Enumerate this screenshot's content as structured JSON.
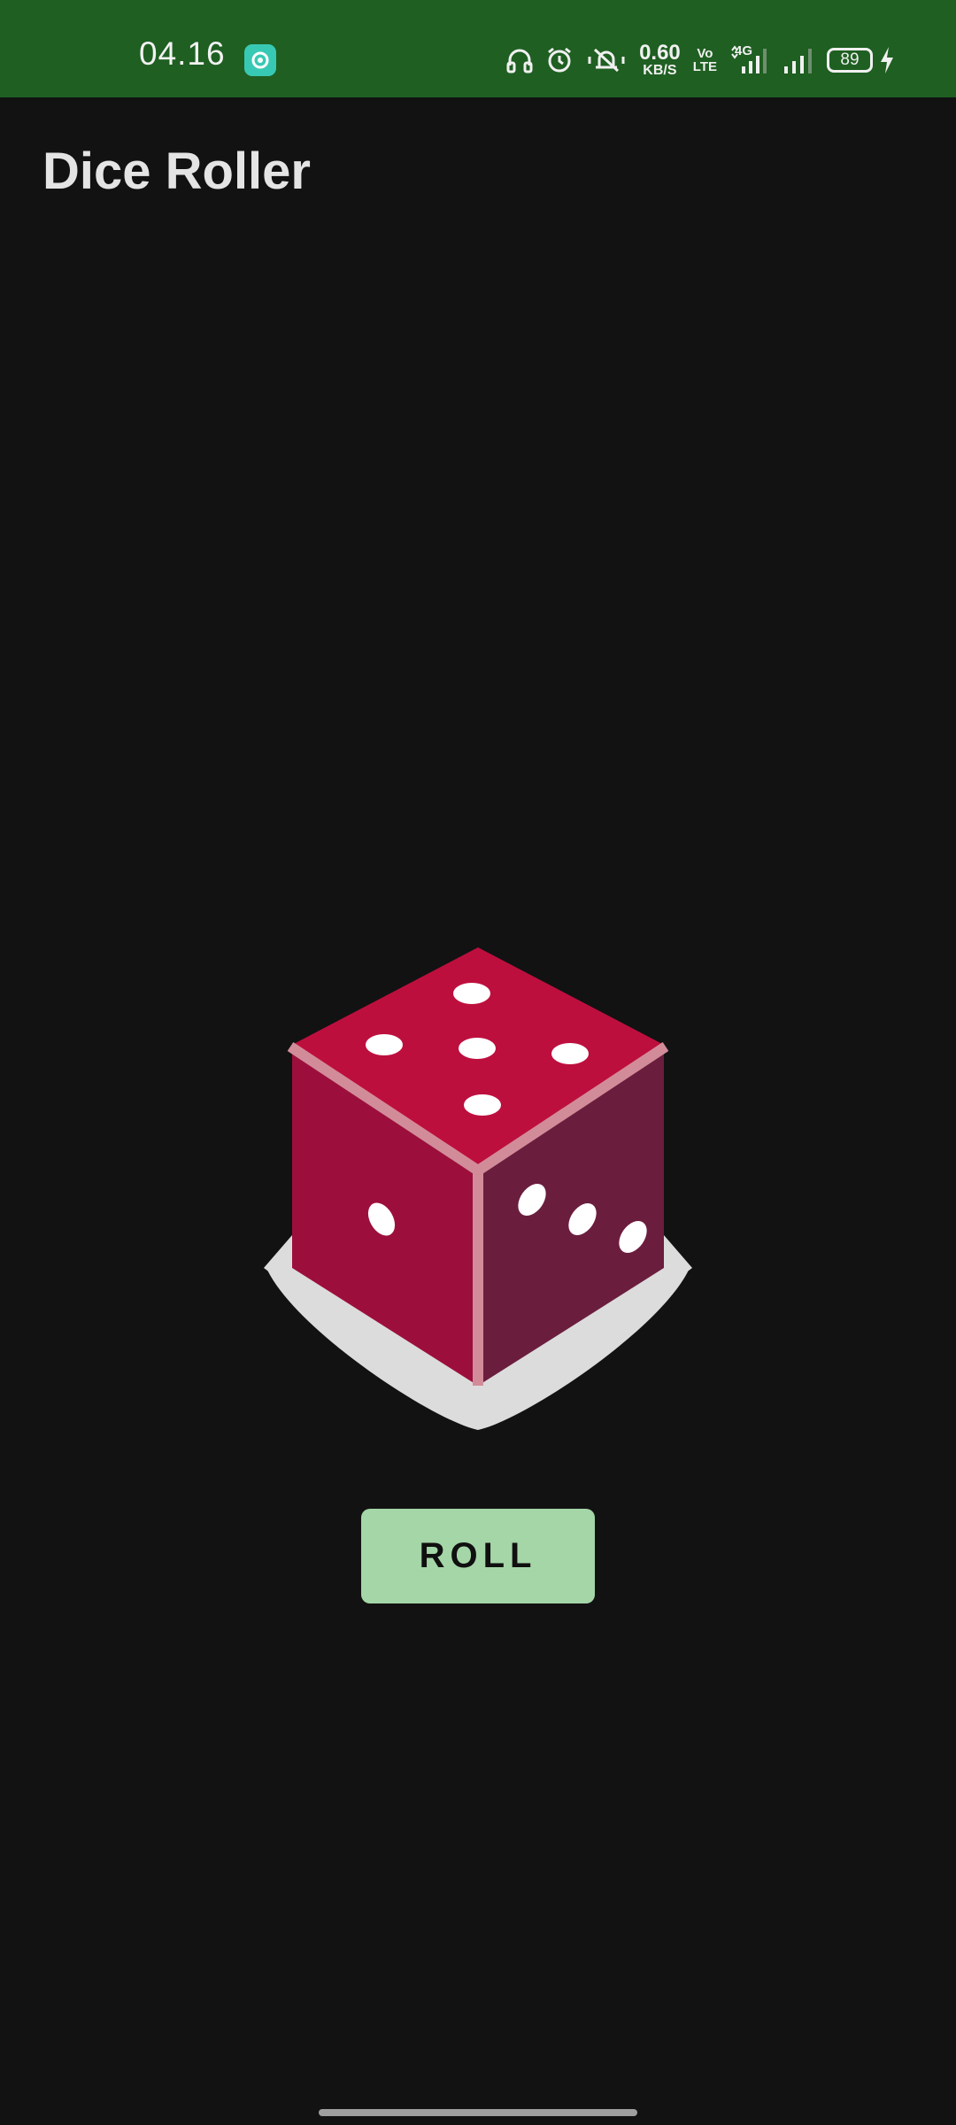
{
  "status_bar": {
    "time": "04.16",
    "net_speed_value": "0.60",
    "net_speed_unit": "KB/S",
    "volte_top": "Vo",
    "volte_bottom": "LTE",
    "network_type": "4G",
    "battery_level": "89",
    "icons": [
      "app-notification-icon",
      "headphones-icon",
      "alarm-icon",
      "mute-vibrate-icon",
      "volte-icon",
      "signal-4g-icon",
      "signal-icon",
      "battery-icon",
      "charging-icon"
    ]
  },
  "app": {
    "title": "Dice Roller"
  },
  "dice": {
    "top_face_pips": 5,
    "left_face_pips": 1,
    "right_face_pips": 3,
    "colors": {
      "top": "#bd0f3e",
      "left": "#9c0f3c",
      "right": "#6b1d3e",
      "edge": "#d28c99",
      "shadow": "#dcdcdc",
      "pip": "#ffffff"
    }
  },
  "roll_button": {
    "label": "ROLL",
    "color": "#a5d6a7"
  }
}
